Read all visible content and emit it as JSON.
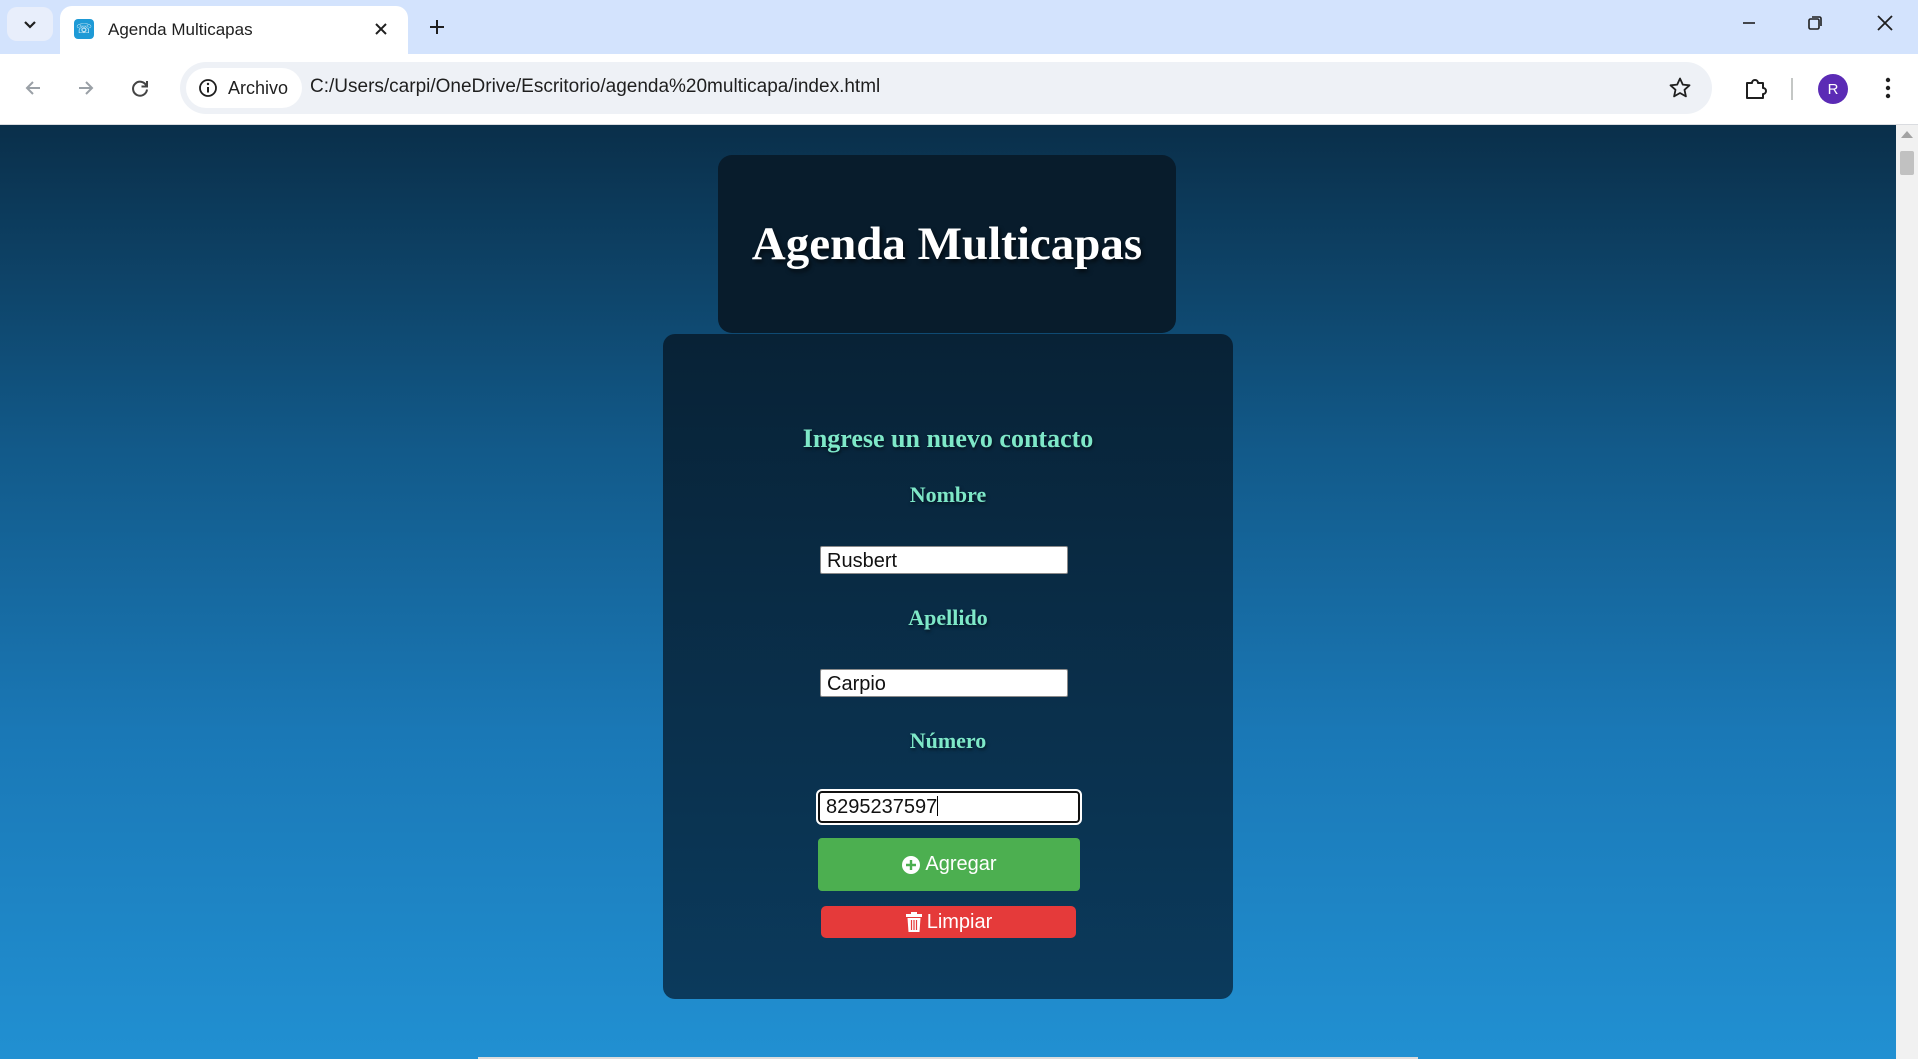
{
  "browser": {
    "tab_title": "Agenda Multicapas",
    "site_chip_label": "Archivo",
    "url": "C:/Users/carpi/OneDrive/Escritorio/agenda%20multicapa/index.html",
    "profile_initial": "R"
  },
  "page": {
    "title": "Agenda Multicapas",
    "form_heading": "Ingrese un nuevo contacto",
    "fields": [
      {
        "label": "Nombre",
        "value": "Rusbert"
      },
      {
        "label": "Apellido",
        "value": "Carpio"
      },
      {
        "label": "Número",
        "value": "8295237597"
      }
    ],
    "add_button_label": "Agregar",
    "clear_button_label": "Limpiar"
  },
  "colors": {
    "accent_text": "#7ee8c8",
    "add_button": "#4caf50",
    "clear_button": "#e53a3a"
  },
  "icons": [
    "tab-search-icon",
    "close-icon",
    "plus-icon",
    "minimize-icon",
    "restore-icon",
    "back-icon",
    "forward-icon",
    "reload-icon",
    "info-icon",
    "star-icon",
    "extensions-icon",
    "more-icon",
    "plus-circle-icon",
    "trash-icon"
  ]
}
